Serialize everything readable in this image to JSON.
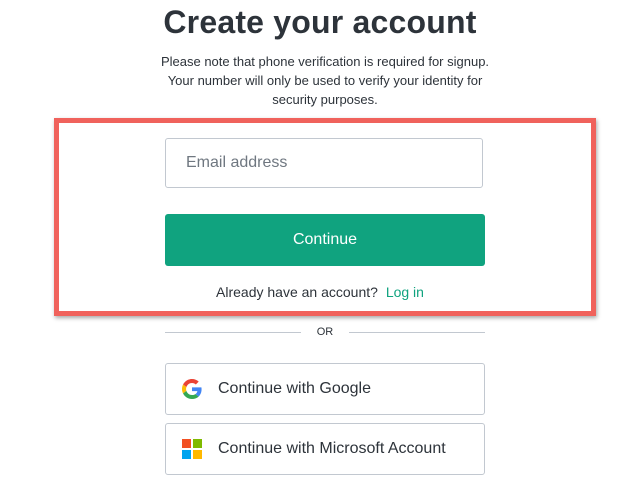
{
  "header": {
    "title": "Create your account",
    "notice": "Please note that phone verification is required for signup. Your number will only be used to verify your identity for security purposes."
  },
  "form": {
    "email_placeholder": "Email address",
    "email_value": "",
    "continue_label": "Continue",
    "login_prompt": "Already have an account?",
    "login_link": "Log in"
  },
  "divider": {
    "label": "OR"
  },
  "social": {
    "google_label": "Continue with Google",
    "google_icon": "google-icon",
    "microsoft_label": "Continue with Microsoft Account",
    "microsoft_icon": "microsoft-icon"
  },
  "colors": {
    "brand": "#10a37f",
    "highlight": "#f0625c",
    "border": "#c2c8d0",
    "ms_red": "#f25022",
    "ms_green": "#7fba00",
    "ms_blue": "#00a4ef",
    "ms_yellow": "#ffb900"
  }
}
